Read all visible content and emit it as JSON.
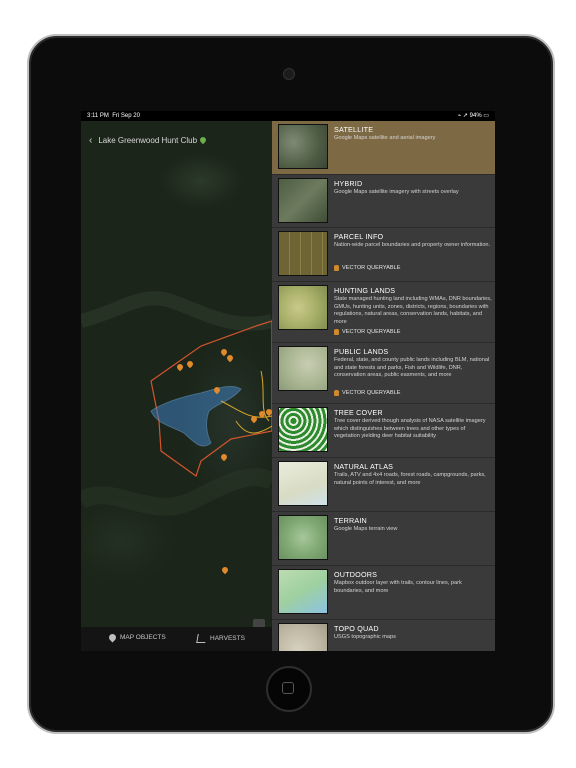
{
  "status": {
    "time": "3:11 PM",
    "date": "Fri Sep 20",
    "battery": "94%"
  },
  "map": {
    "title": "Lake Greenwood Hunt Club"
  },
  "bottom_bar": [
    {
      "label": "MAP OBJECTS",
      "icon": "map-pin-icon"
    },
    {
      "label": "HARVESTS",
      "icon": "antler-icon"
    }
  ],
  "vector_queryable_label": "VECTOR QUERYABLE",
  "layers": [
    {
      "title": "SATELLITE",
      "desc": "Google Maps satellite and aerial imagery",
      "selected": true,
      "vector": false
    },
    {
      "title": "HYBRID",
      "desc": "Google Maps satellite imagery with streets overlay",
      "selected": false,
      "vector": false
    },
    {
      "title": "PARCEL INFO",
      "desc": "Nation-wide parcel boundaries and property owner information.",
      "selected": false,
      "vector": true
    },
    {
      "title": "HUNTING LANDS",
      "desc": "State managed hunting land including WMAs, DNR boundaries, GMUs, hunting units, zones, districts, regions, boundaries with regulations, natural areas, conservation lands, habitats, and more",
      "selected": false,
      "vector": true
    },
    {
      "title": "PUBLIC LANDS",
      "desc": "Federal, state, and county public lands including BLM, national and state forests and parks, Fish and Wildlife, DNR, conservation areas, public easments, and more",
      "selected": false,
      "vector": true
    },
    {
      "title": "TREE COVER",
      "desc": "Tree cover derived though analysis of NASA satellite imagery which distinguishes between trees and other types of vegetation yielding deer habitat suitability",
      "selected": false,
      "vector": false
    },
    {
      "title": "NATURAL ATLAS",
      "desc": "Trails, ATV and 4x4 roads, forest roads, campgrounds, parks, natural points of interest, and more",
      "selected": false,
      "vector": false
    },
    {
      "title": "TERRAIN",
      "desc": "Google Maps terrain view",
      "selected": false,
      "vector": false
    },
    {
      "title": "OUTDOORS",
      "desc": "Mapbox outdoor layer with trails, contour lines, park boundaries, and more",
      "selected": false,
      "vector": false
    },
    {
      "title": "TOPO QUAD",
      "desc": "USGS topographic maps",
      "selected": false,
      "vector": false
    }
  ],
  "colors": {
    "selected_row": "#7d6a45",
    "panel_bg": "#3a3a3a",
    "marker": "#e08a2c",
    "lake": "#3f7fc0"
  }
}
